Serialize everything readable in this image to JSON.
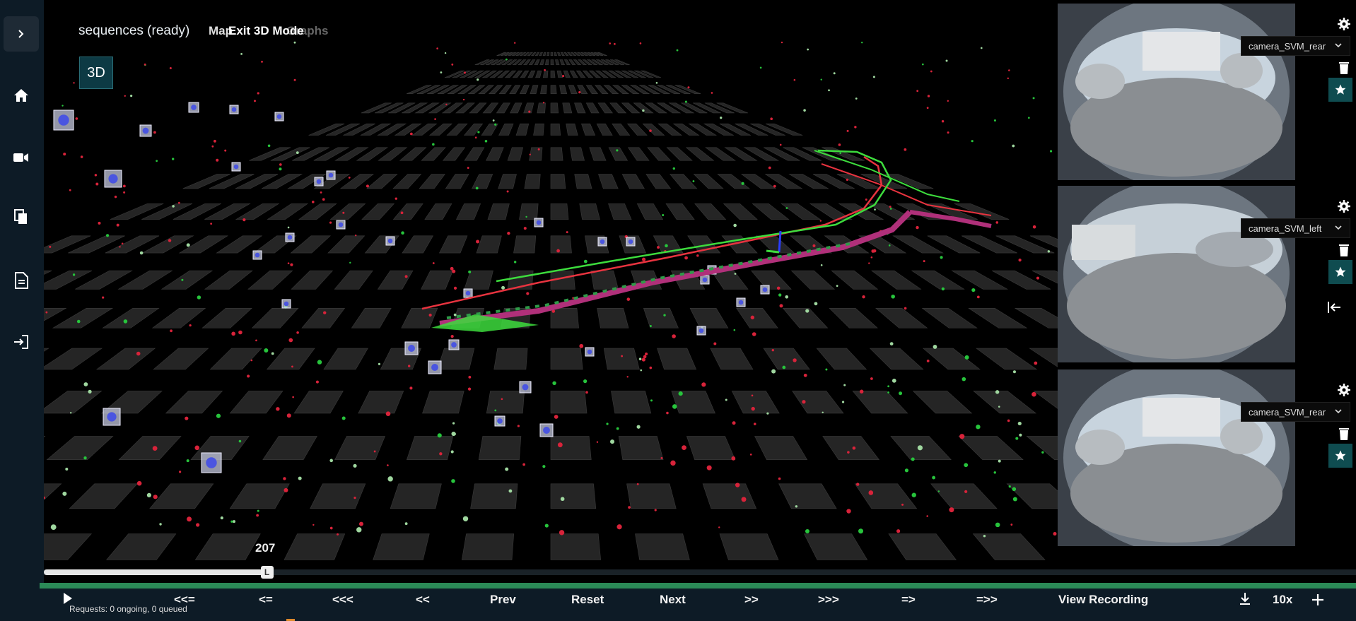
{
  "header": {
    "title": "sequences (ready)",
    "tab_map": "Map",
    "tab_exit3d": "Exit 3D Mode",
    "tab_graphs": "Graphs",
    "btn_3d": "3D"
  },
  "sidebar": {
    "items": [
      {
        "icon": "chevron-right-icon"
      },
      {
        "icon": "home-icon"
      },
      {
        "icon": "video-camera-icon"
      },
      {
        "icon": "copy-icon"
      },
      {
        "icon": "document-icon"
      },
      {
        "icon": "login-icon"
      }
    ]
  },
  "cameras": [
    {
      "name": "camera_SVM_rear"
    },
    {
      "name": "camera_SVM_left"
    },
    {
      "name": "camera_SVM_rear"
    }
  ],
  "timeline": {
    "frame": "207",
    "handle_label": "L",
    "progress_fraction": 0.17
  },
  "controls": {
    "jump_start": "<<=",
    "step_back_single": "<=",
    "rewind_fast": "<<<",
    "rewind": "<<",
    "prev": "Prev",
    "reset": "Reset",
    "next": "Next",
    "forward": ">>",
    "forward_fast": ">>>",
    "step_forward_single": "=>",
    "jump_end": "=>>",
    "view_recording": "View Recording",
    "speed": "10x",
    "requests": "Requests: 0 ongoing, 0 queued"
  },
  "colors": {
    "sidebar_bg": "#0d1b26",
    "accent_teal": "#0f4c50",
    "timeline_green": "#2b8a57",
    "trajectory_red": "#e8333f",
    "trajectory_green": "#3ddc3d",
    "trajectory_magenta": "#b0307a"
  }
}
